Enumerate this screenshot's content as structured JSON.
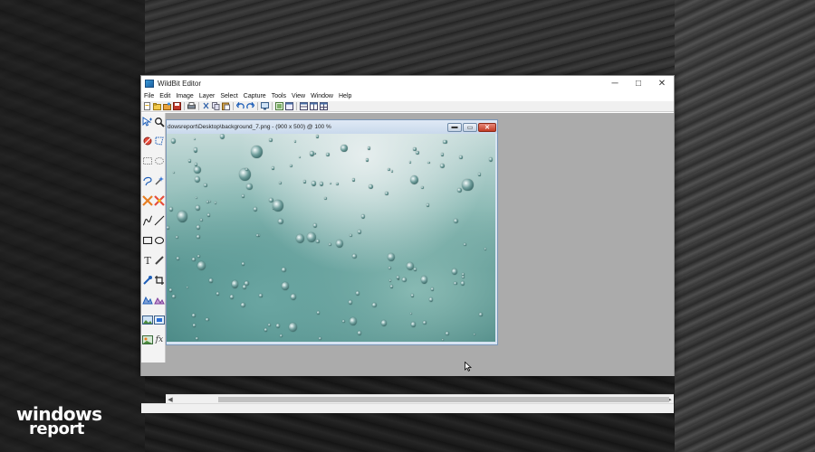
{
  "window": {
    "title": "WildBit Editor",
    "controls": {
      "minimize": "─",
      "maximize": "□",
      "close": "✕"
    }
  },
  "menu": [
    "File",
    "Edit",
    "Image",
    "Layer",
    "Select",
    "Capture",
    "Tools",
    "View",
    "Window",
    "Help"
  ],
  "toolbar": {
    "buttons": [
      "new-icon",
      "open-icon",
      "open-folder-icon",
      "save-icon",
      "print-icon",
      "cut-icon",
      "copy-icon",
      "paste-icon",
      "undo-icon",
      "redo-icon",
      "screen-icon",
      "capture-icon",
      "capture-window-icon",
      "tile-vertical-icon",
      "tile-horizontal-icon",
      "cascade-icon"
    ]
  },
  "tools": [
    "move-icon",
    "zoom-icon",
    "eraser-icon",
    "lasso-icon",
    "rect-select-icon",
    "ellipse-select-icon",
    "freeform-select-icon",
    "magic-wand-icon",
    "color-replace-icon",
    "clone-icon",
    "curve-icon",
    "line-icon",
    "rectangle-icon",
    "ellipse-icon",
    "text-icon",
    "brush-icon",
    "eyedropper-icon",
    "crop-icon",
    "sharpen-icon",
    "blur-icon",
    "image-icon",
    "image-adjust-icon",
    "layer-icon",
    "fx-icon"
  ],
  "document": {
    "title": "dowsreport\\Desktop\\background_7.png - (900 x 500) @ 100 %",
    "controls": {
      "minimize": "▬",
      "maximize": "▭",
      "close": "✕"
    }
  },
  "tool_glyphs": {
    "text": "T",
    "fx": "fx"
  },
  "watermark": {
    "line1": "windows",
    "line2": "report"
  },
  "colors": {
    "window_bg": "#ffffff",
    "workspace_bg": "#ababab",
    "doc_border": "#7a96b8",
    "close_red": "#c23b24"
  }
}
